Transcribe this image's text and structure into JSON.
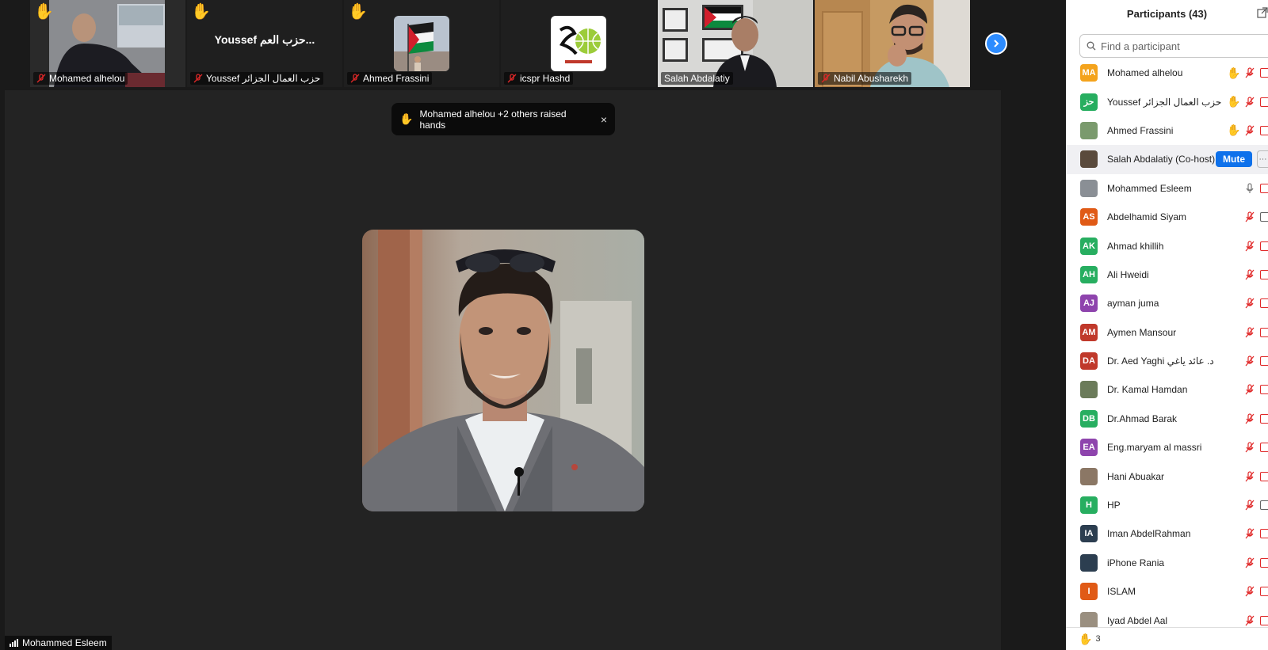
{
  "thumbnails": [
    {
      "name": "Mohamed alhelou",
      "hand": true,
      "kind": "photo-man-dark"
    },
    {
      "name": "Youssef حزب العمال الجزائر",
      "hand": true,
      "kind": "text",
      "display_name": "Youssef حزب العم..."
    },
    {
      "name": "Ahmed Frassini",
      "hand": true,
      "kind": "flag-avatar"
    },
    {
      "name": "icspr Hashd",
      "hand": false,
      "kind": "logo-avatar"
    },
    {
      "name": "Salah Abdalatiy",
      "hand": false,
      "kind": "photo-office",
      "muted": false
    },
    {
      "name": "Nabil Abusharekh",
      "hand": false,
      "kind": "photo-glasses"
    }
  ],
  "toast": {
    "text": "Mohamed alhelou +2 others raised hands",
    "close": "×"
  },
  "main": {
    "speaker_name": "Mohammed Esleem"
  },
  "participants": {
    "title": "Participants (43)",
    "search_placeholder": "Find a participant",
    "mute_label": "Mute",
    "raised_count": "3",
    "list": [
      {
        "initials": "MA",
        "name": "Mohamed alhelou",
        "color": "#f4a31c",
        "hand": true
      },
      {
        "initials": "حز",
        "name": "Youssef حزب العمال الجزائر",
        "color": "#27ae60",
        "hand": true
      },
      {
        "initials": "",
        "name": "Ahmed Frassini",
        "color": "#7a9a6d",
        "hand": true,
        "photo": true
      },
      {
        "initials": "",
        "name": "Salah Abdalatiy (Co-host)",
        "color": "#5a4a3c",
        "photo": true,
        "cohost": true
      },
      {
        "initials": "",
        "name": "Mohammed Esleem",
        "color": "#8a8f95",
        "photo": true,
        "speaking": true
      },
      {
        "initials": "AS",
        "name": "Abdelhamid Siyam",
        "color": "#e05a16",
        "gray_vid": true
      },
      {
        "initials": "AK",
        "name": "Ahmad khillih",
        "color": "#27ae60"
      },
      {
        "initials": "AH",
        "name": "Ali Hweidi",
        "color": "#27ae60"
      },
      {
        "initials": "AJ",
        "name": "ayman juma",
        "color": "#8e44ad"
      },
      {
        "initials": "AM",
        "name": "Aymen Mansour",
        "color": "#c0392b"
      },
      {
        "initials": "DA",
        "name": "Dr. Aed Yaghi  د. عائد ياغي",
        "color": "#c0392b"
      },
      {
        "initials": "",
        "name": "Dr. Kamal Hamdan",
        "color": "#6b7b5a",
        "photo": true
      },
      {
        "initials": "DB",
        "name": "Dr.Ahmad Barak",
        "color": "#27ae60"
      },
      {
        "initials": "EA",
        "name": "Eng.maryam al massri",
        "color": "#8e44ad"
      },
      {
        "initials": "",
        "name": "Hani Abuakar",
        "color": "#8b7765",
        "photo": true
      },
      {
        "initials": "H",
        "name": "HP",
        "color": "#27ae60",
        "gray_vid": true
      },
      {
        "initials": "IA",
        "name": "Iman AbdelRahman",
        "color": "#2c3e50"
      },
      {
        "initials": "",
        "name": "iPhone Rania",
        "color": "#2c3e50"
      },
      {
        "initials": "I",
        "name": "ISLAM",
        "color": "#e05a16"
      },
      {
        "initials": "",
        "name": "Iyad Abdel Aal",
        "color": "#9a8f80",
        "photo": true
      }
    ]
  }
}
